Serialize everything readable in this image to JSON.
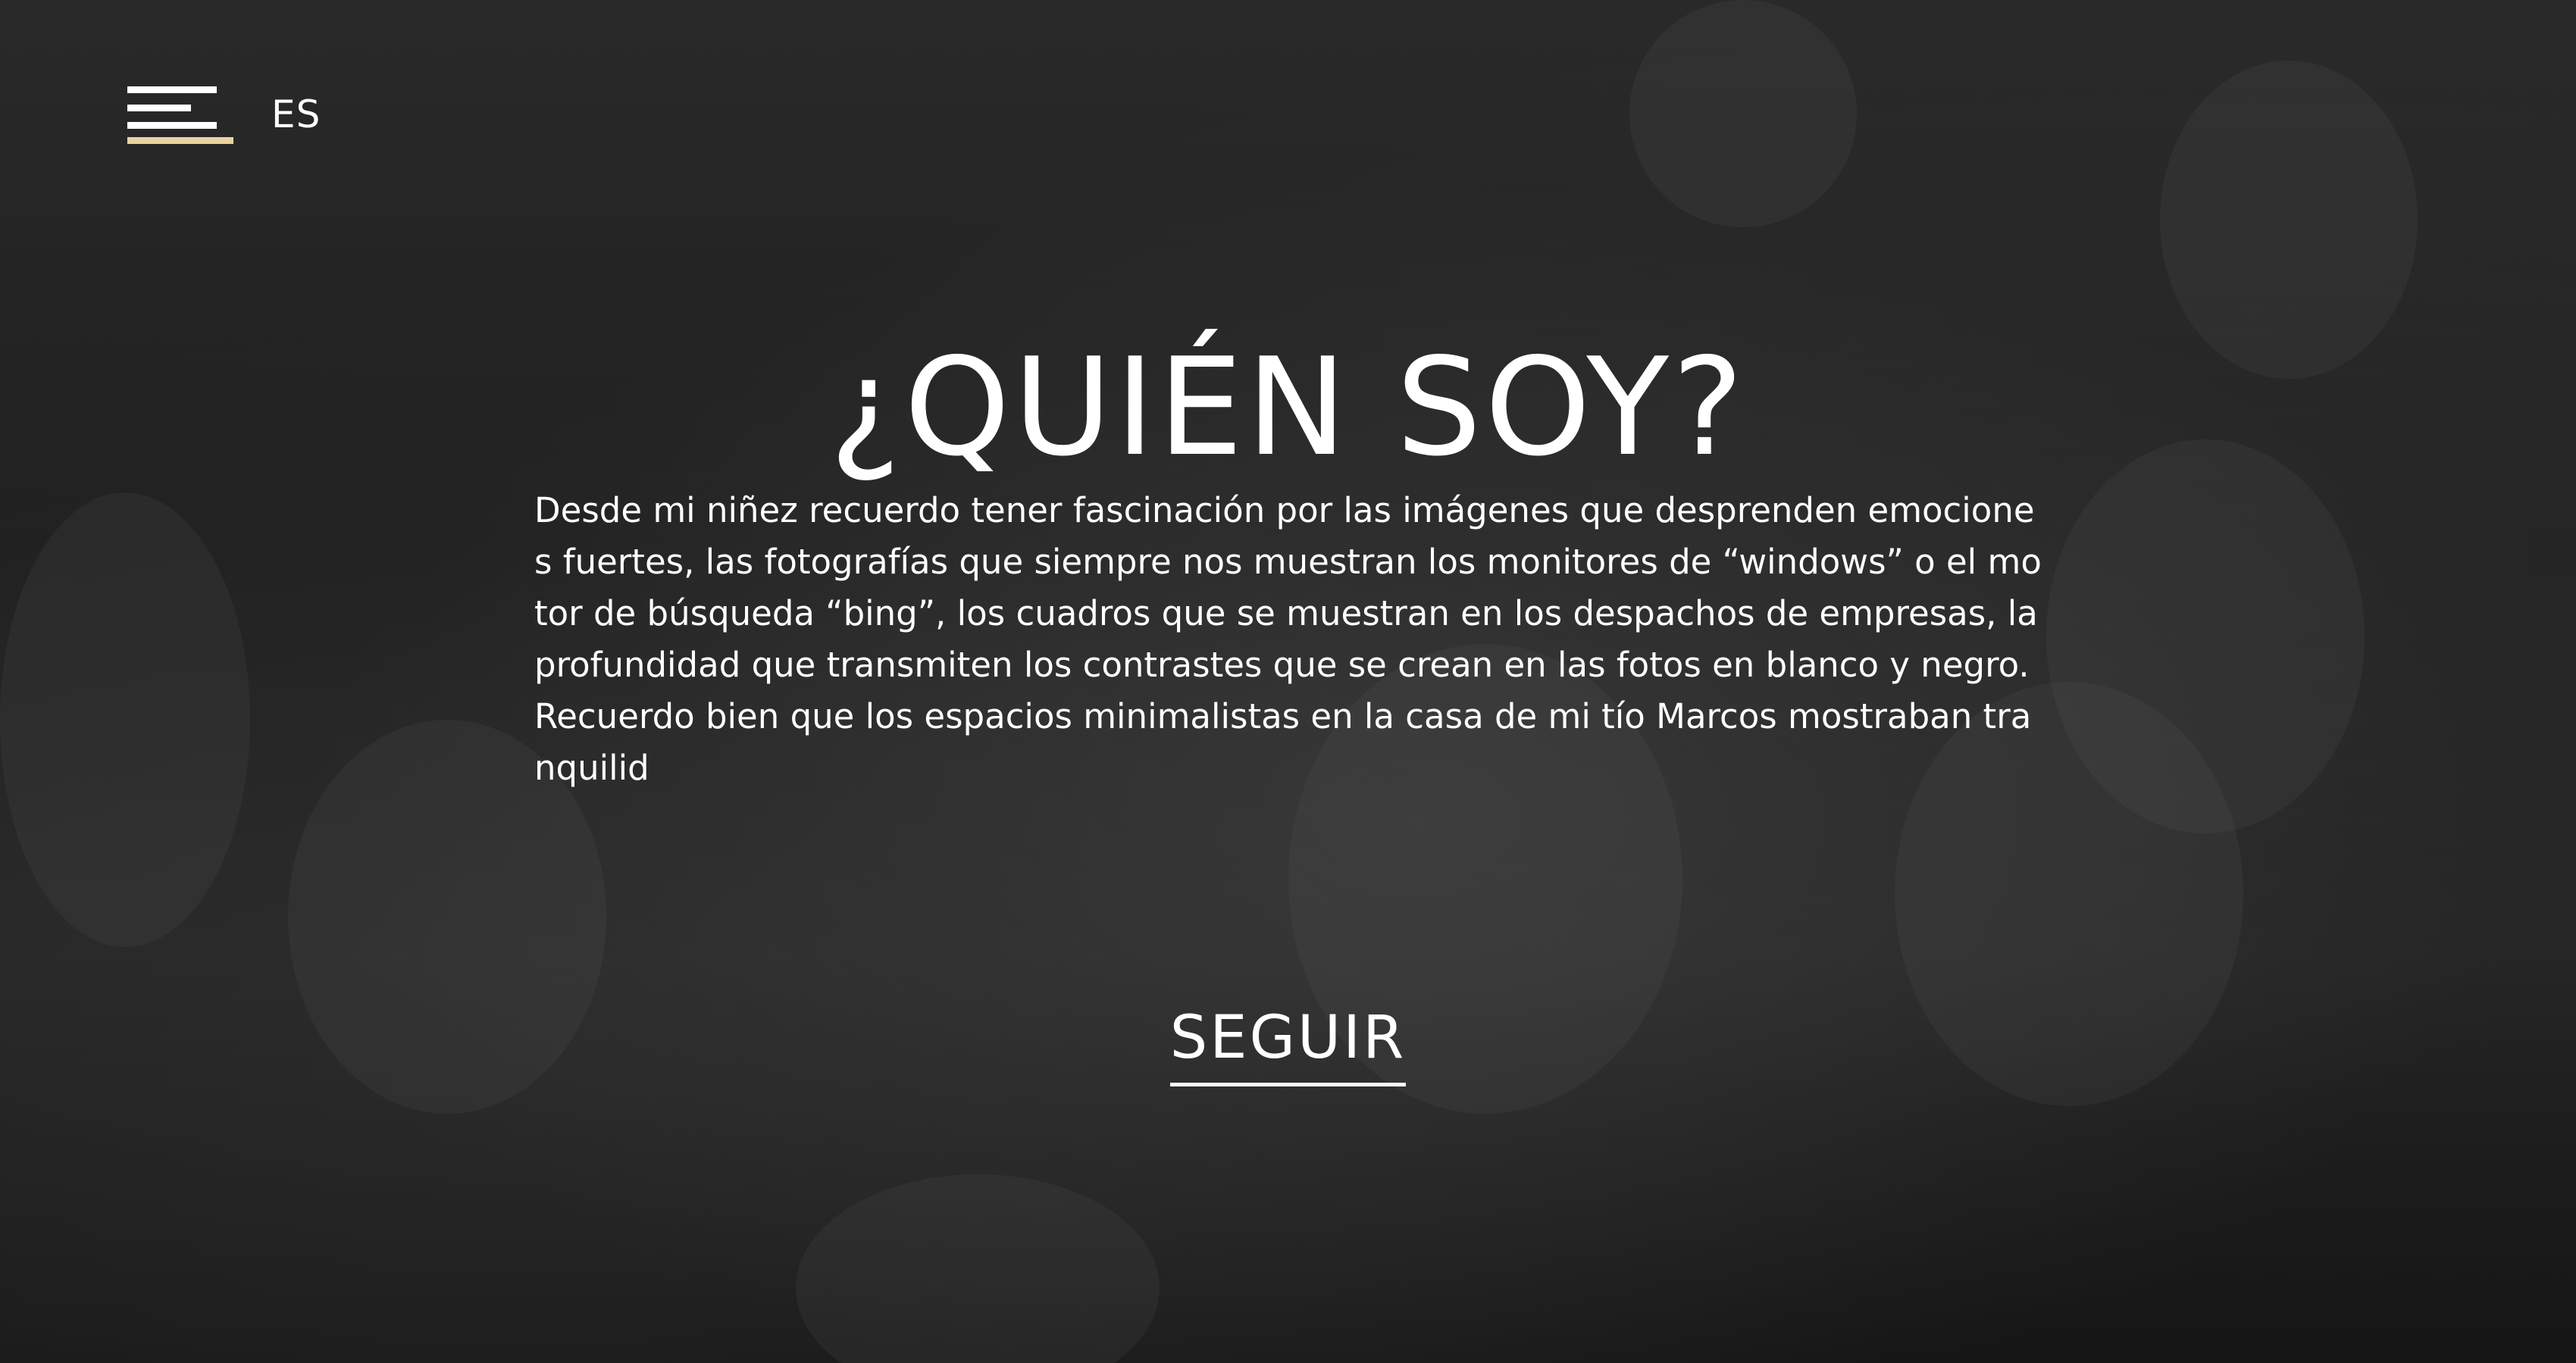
{
  "header": {
    "menu_icon": "hamburger-menu-icon",
    "language": "ES"
  },
  "hero": {
    "title": "¿QUIÉN SOY?",
    "intro": "Desde mi niñez recuerdo tener fascinación por las imágenes que desprenden emociones fuertes, las fotografías que siempre nos muestran los monitores de “windows” o el motor de búsqueda “bing”, los cuadros que se muestran en los despachos de empresas, la profundidad que transmiten los contrastes que se crean en las fotos en blanco y negro. Recuerdo bien que los espacios minimalistas en la casa de mi tío Marcos mostraban tranquilid",
    "cta_label": "SEGUIR"
  },
  "colors": {
    "accent": "#e8d3a0",
    "text": "#ffffff"
  }
}
